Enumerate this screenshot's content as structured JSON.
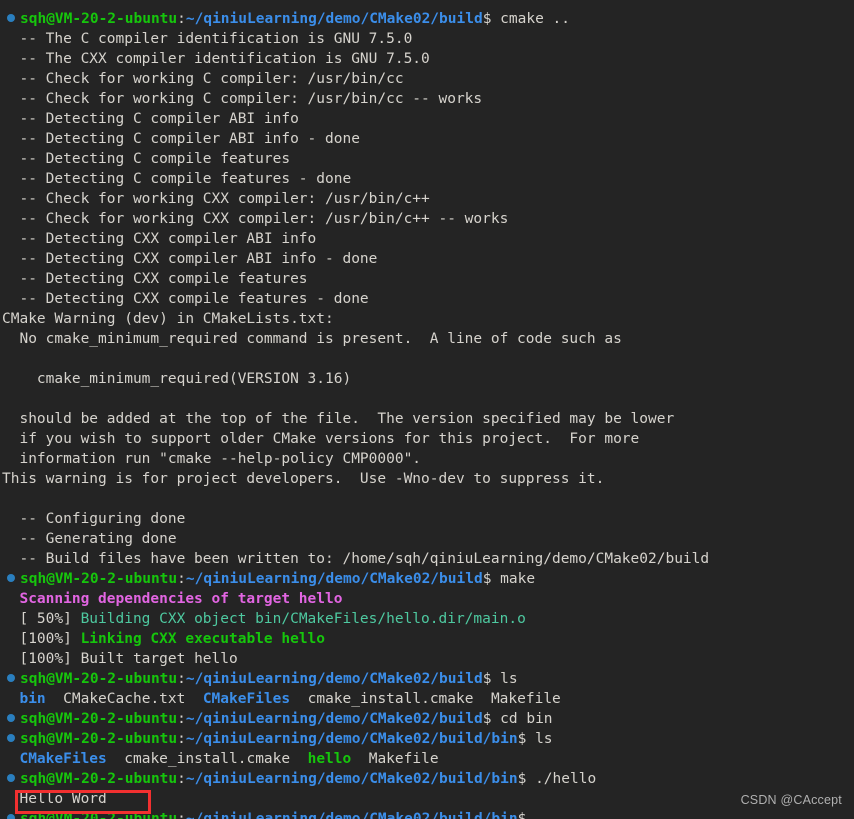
{
  "terminal": {
    "background_color": "#242424",
    "foreground_color": "#d6d3cd",
    "colors": {
      "user_green": "#16c60c",
      "path_blue": "#3b8eea",
      "magenta": "#e265e2",
      "green_light": "#4ec9a0",
      "bullet_blue": "#2a7fbf",
      "highlight_red": "#f23030",
      "watermark_gray": "#b0b0b0"
    },
    "prompt": {
      "user_host": "sqh@VM-20-2-ubuntu",
      "separator": ":",
      "path_build": "~/qiniuLearning/demo/CMake02/build",
      "path_bin": "~/qiniuLearning/demo/CMake02/build/bin",
      "sigil": "$"
    },
    "commands": {
      "cmake": " cmake ..",
      "make": " make",
      "ls": " ls",
      "cd_bin": " cd bin",
      "run_hello": " ./hello"
    },
    "cmake_output": [
      "  -- The C compiler identification is GNU 7.5.0",
      "  -- The CXX compiler identification is GNU 7.5.0",
      "  -- Check for working C compiler: /usr/bin/cc",
      "  -- Check for working C compiler: /usr/bin/cc -- works",
      "  -- Detecting C compiler ABI info",
      "  -- Detecting C compiler ABI info - done",
      "  -- Detecting C compile features",
      "  -- Detecting C compile features - done",
      "  -- Check for working CXX compiler: /usr/bin/c++",
      "  -- Check for working CXX compiler: /usr/bin/c++ -- works",
      "  -- Detecting CXX compiler ABI info",
      "  -- Detecting CXX compiler ABI info - done",
      "  -- Detecting CXX compile features",
      "  -- Detecting CXX compile features - done",
      "CMake Warning (dev) in CMakeLists.txt:",
      "  No cmake_minimum_required command is present.  A line of code such as",
      "",
      "    cmake_minimum_required(VERSION 3.16)",
      "",
      "  should be added at the top of the file.  The version specified may be lower",
      "  if you wish to support older CMake versions for this project.  For more",
      "  information run \"cmake --help-policy CMP0000\".",
      "This warning is for project developers.  Use -Wno-dev to suppress it.",
      "",
      "  -- Configuring done",
      "  -- Generating done",
      "  -- Build files have been written to: /home/sqh/qiniuLearning/demo/CMake02/build"
    ],
    "make_output": {
      "scanning": "  Scanning dependencies of target hello",
      "building_pct": "  [ 50%] ",
      "building_text": "Building CXX object bin/CMakeFiles/hello.dir/main.o",
      "linking_pct": "  [100%] ",
      "linking_text": "Linking CXX executable hello",
      "built_pct": "  [100%] ",
      "built_text": "Built target hello"
    },
    "ls_build": {
      "bin": "bin",
      "cmakecache": "CMakeCache.txt",
      "cmakefiles": "CMakeFiles",
      "cmake_install": "cmake_install.cmake",
      "makefile": "Makefile"
    },
    "ls_bin": {
      "cmakefiles": "CMakeFiles",
      "cmake_install": "cmake_install.cmake",
      "hello": "hello",
      "makefile": "Makefile"
    },
    "program_output": "Hello Word",
    "watermark": "CSDN @CAccept"
  }
}
